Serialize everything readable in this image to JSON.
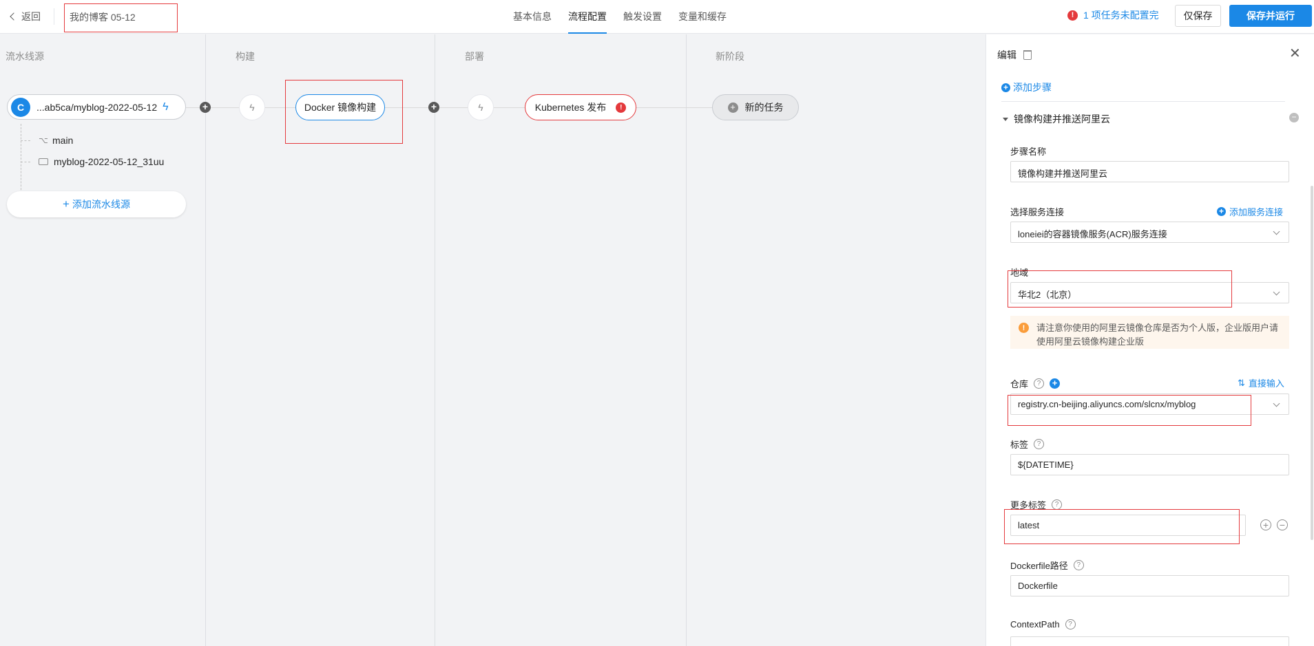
{
  "header": {
    "back_label": "返回",
    "pipeline_title": "我的博客 05-12",
    "tabs": [
      {
        "label": "基本信息",
        "active": false
      },
      {
        "label": "流程配置",
        "active": true
      },
      {
        "label": "触发设置",
        "active": false
      },
      {
        "label": "变量和缓存",
        "active": false
      }
    ],
    "warning_text": "1 项任务未配置完",
    "save_only_label": "仅保存",
    "save_run_label": "保存并运行"
  },
  "pipeline": {
    "stages": [
      "流水线源",
      "构建",
      "部署",
      "新阶段"
    ],
    "source": {
      "label": "...ab5ca/myblog-2022-05-12",
      "icon": "codeup-logo-icon",
      "branch": "main",
      "repo": "myblog-2022-05-12_31uu"
    },
    "add_source_label": "添加流水线源",
    "jobs": {
      "build": "Docker 镜像构建",
      "deploy": "Kubernetes 发布",
      "new_task": "新的任务"
    },
    "error_badge": "!"
  },
  "panel": {
    "title": "编辑",
    "add_step_label": "添加步骤",
    "step_title": "镜像构建并推送阿里云",
    "fields": {
      "step_name": {
        "label": "步骤名称",
        "value": "镜像构建并推送阿里云"
      },
      "service_connection": {
        "label": "选择服务连接",
        "value": "loneiei的容器镜像服务(ACR)服务连接",
        "link": "添加服务连接"
      },
      "region": {
        "label": "地域",
        "value": "华北2（北京）"
      },
      "notice": "请注意你使用的阿里云镜像仓库是否为个人版，企业版用户请使用阿里云镜像构建企业版",
      "repository": {
        "label": "仓库",
        "value": "registry.cn-beijing.aliyuncs.com/slcnx/myblog",
        "link": "直接输入"
      },
      "tag": {
        "label": "标签",
        "value": "${DATETIME}"
      },
      "more_tags": {
        "label": "更多标签",
        "value": "latest"
      },
      "dockerfile": {
        "label": "Dockerfile路径",
        "value": "Dockerfile"
      },
      "context_path": {
        "label": "ContextPath",
        "value": ""
      }
    }
  },
  "colors": {
    "accent": "#1b88e6",
    "error": "#e4393c",
    "warning": "#fa9d3b"
  }
}
